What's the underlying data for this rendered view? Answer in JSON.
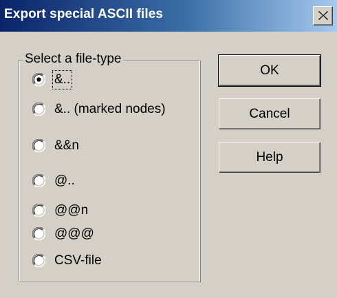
{
  "window": {
    "title": "Export special ASCII files"
  },
  "group": {
    "label": "Select a file-type",
    "options": [
      {
        "label": "&..",
        "selected": true
      },
      {
        "label": "&.. (marked nodes)",
        "selected": false
      },
      {
        "label": "&&n",
        "selected": false
      },
      {
        "label": "@..",
        "selected": false
      },
      {
        "label": "@@n",
        "selected": false
      },
      {
        "label": "@@@",
        "selected": false
      },
      {
        "label": "CSV-file",
        "selected": false
      }
    ]
  },
  "buttons": {
    "ok": "OK",
    "cancel": "Cancel",
    "help": "Help"
  },
  "colors": {
    "titlebar_start": "#0a246a",
    "titlebar_end": "#a6caf0",
    "face": "#d4d0c8"
  },
  "icons": {
    "close": "close-icon",
    "radio": "radio-button-icon"
  }
}
